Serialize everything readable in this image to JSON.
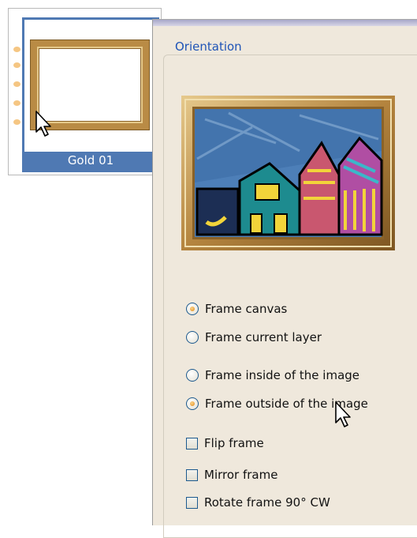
{
  "thumbnail": {
    "label": "Gold 01",
    "selected": true
  },
  "dialog": {
    "group_title": "Orientation",
    "radio_group_1": [
      {
        "label": "Frame canvas",
        "checked": true
      },
      {
        "label": "Frame current layer",
        "checked": false
      }
    ],
    "radio_group_2": [
      {
        "label": "Frame inside of the image",
        "checked": false
      },
      {
        "label": "Frame outside of the image",
        "checked": true
      }
    ],
    "checkboxes": [
      {
        "label": "Flip frame",
        "checked": false
      },
      {
        "label": "Mirror frame",
        "checked": false
      },
      {
        "label": "Rotate frame 90° CW",
        "checked": false
      }
    ]
  },
  "colors": {
    "selection_blue": "#4f79b3",
    "group_title": "#1f54b7",
    "panel_bg": "#efe8dc",
    "frame_gold": "#b98b45"
  },
  "icons": [
    "arrow-cursor-icon",
    "arrow-cursor-icon"
  ]
}
